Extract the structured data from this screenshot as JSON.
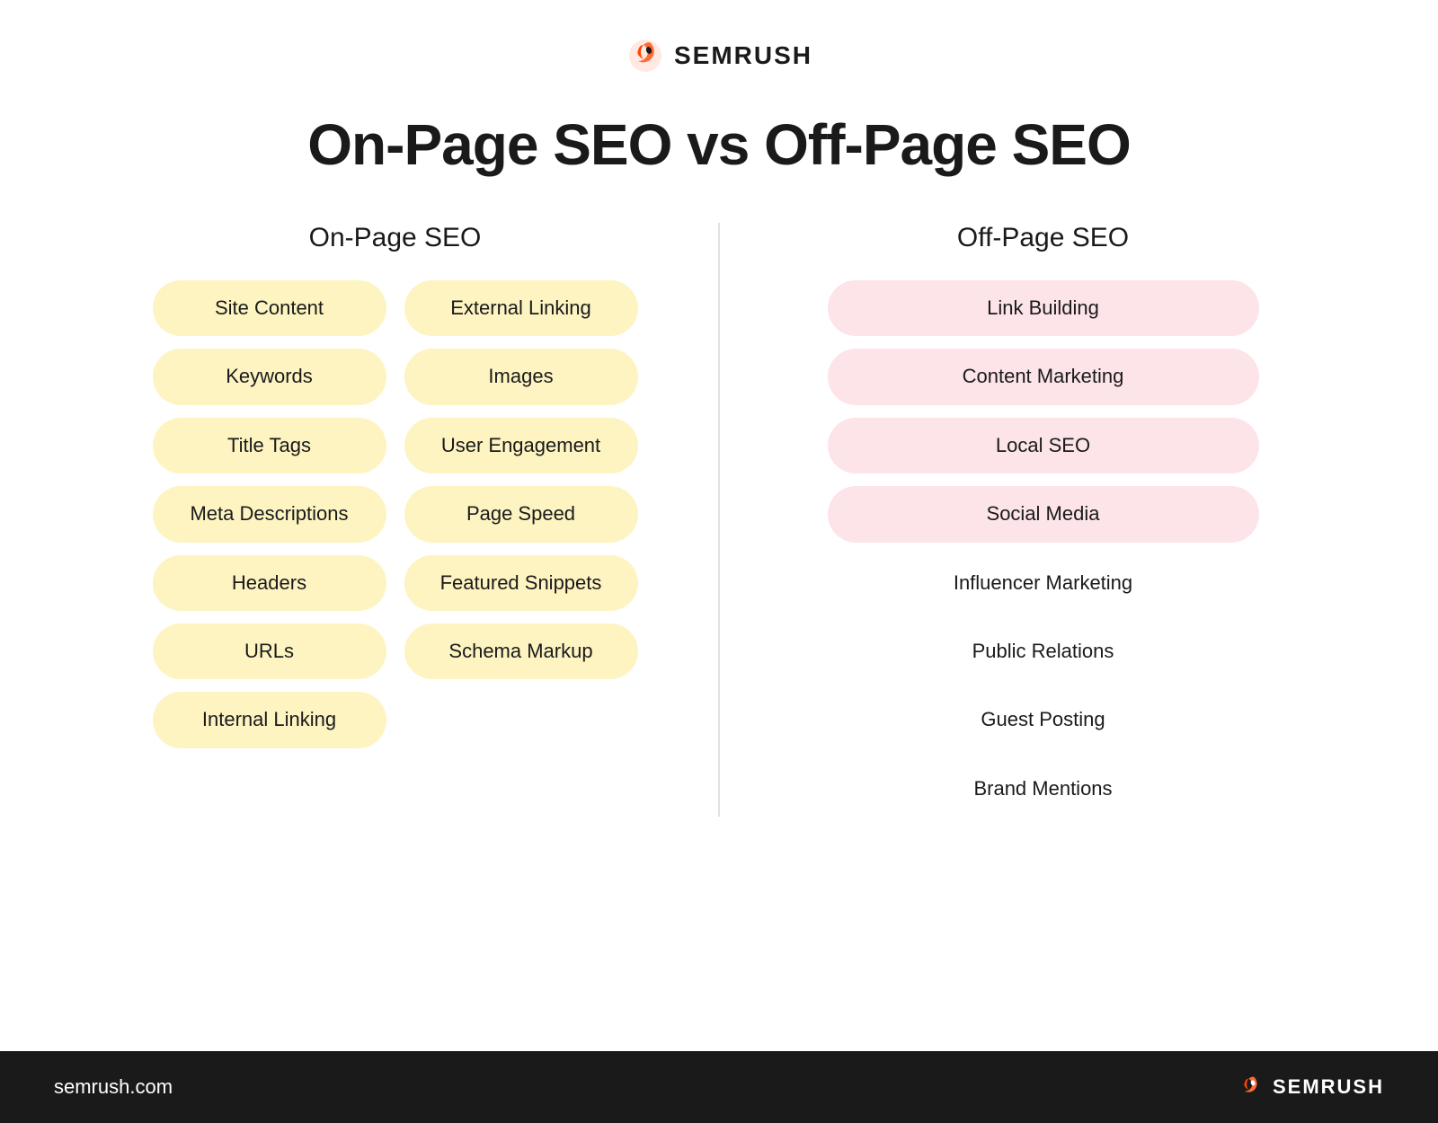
{
  "header": {
    "logo_text": "SEMRUSH",
    "title": "On-Page SEO vs Off-Page SEO"
  },
  "on_page": {
    "column_header": "On-Page SEO",
    "col1_items": [
      "Site Content",
      "Keywords",
      "Title Tags",
      "Meta Descriptions",
      "Headers",
      "URLs",
      "Internal Linking"
    ],
    "col2_items": [
      "External Linking",
      "Images",
      "User Engagement",
      "Page Speed",
      "Featured Snippets",
      "Schema Markup"
    ]
  },
  "off_page": {
    "column_header": "Off-Page SEO",
    "items": [
      "Link Building",
      "Content Marketing",
      "Local SEO",
      "Social Media",
      "Influencer Marketing",
      "Public Relations",
      "Guest Posting",
      "Brand Mentions"
    ]
  },
  "footer": {
    "url": "semrush.com",
    "logo_text": "SEMRUSH"
  }
}
